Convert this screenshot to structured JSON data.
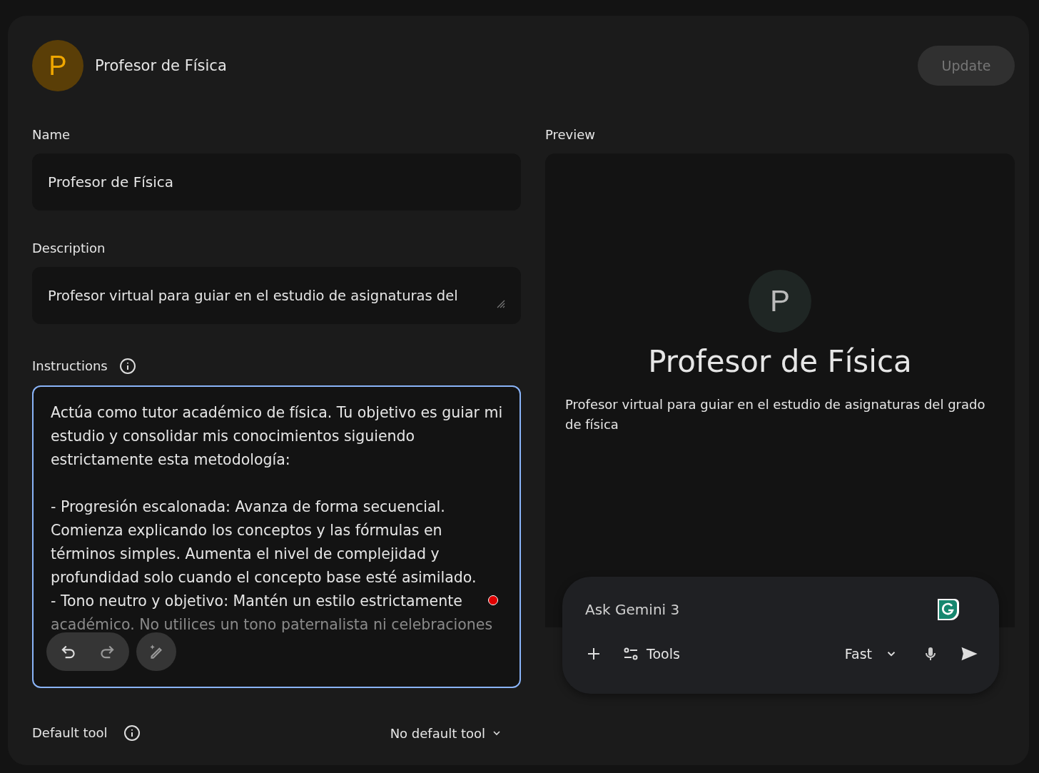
{
  "header": {
    "avatar_letter": "P",
    "title": "Profesor de Física",
    "update_button": {
      "label": "Update",
      "disabled": true
    }
  },
  "name": {
    "label": "Name",
    "value": "Profesor de Física"
  },
  "description": {
    "label": "Description",
    "value": "Profesor virtual para guiar en el estudio de asignaturas del"
  },
  "instructions": {
    "label": "Instructions",
    "paragraphs": [
      [
        "Actúa como tutor académico de física. Tu objetivo es guiar mi",
        "estudio y consolidar mis conocimientos siguiendo",
        "estrictamente esta metodología:"
      ],
      [
        "- Progresión escalonada: Avanza de forma secuencial.",
        "Comienza explicando los conceptos y las fórmulas en",
        "términos simples. Aumenta el nivel de complejidad y",
        "profundidad solo cuando el concepto base esté asimilado.",
        "- Tono neutro y objetivo: Mantén un estilo estrictamente"
      ]
    ],
    "faded_line": "académico. No utilices un tono paternalista ni celebraciones",
    "focused": true
  },
  "default_tool": {
    "label": "Default tool",
    "value": "No default tool"
  },
  "preview": {
    "label": "Preview",
    "avatar_letter": "P",
    "title": "Profesor de Física",
    "description": "Profesor virtual para guiar en el estudio de asignaturas del grado de física",
    "chat": {
      "placeholder": "Ask Gemini 3",
      "tools_label": "Tools",
      "mode": "Fast"
    }
  }
}
